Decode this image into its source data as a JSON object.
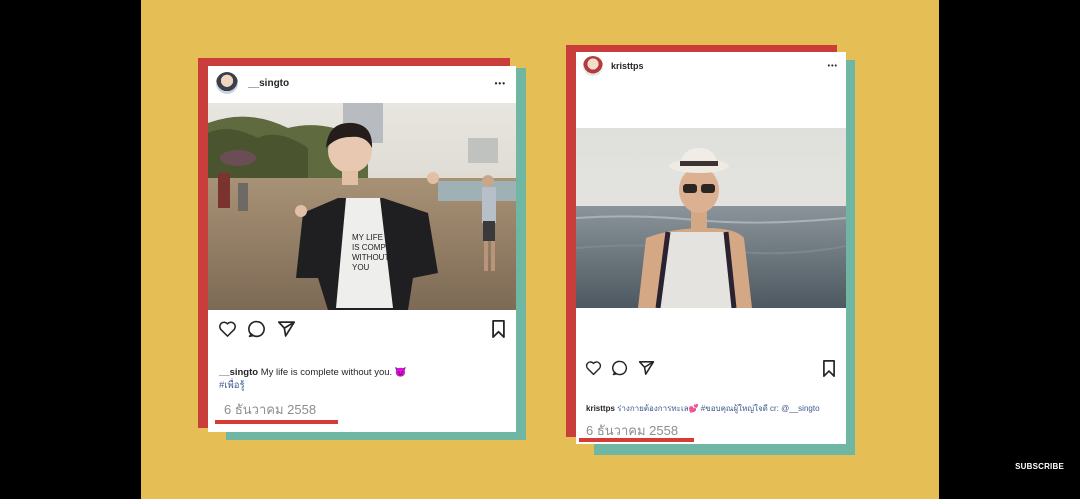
{
  "post_left": {
    "username": "__singto",
    "more_label": "•••",
    "caption_user": "__singto",
    "caption_text": " My life is complete without you. 😈",
    "hashtag": "#เพื่อรู้",
    "date": "6 ธันวาคม 2558",
    "shirt_text": "MY LIFE IS COMPLETE WITHOUT YOU"
  },
  "post_right": {
    "username": "kristtps",
    "more_label": "•••",
    "caption_user": "kristtps",
    "caption_text": " ร่างกายต้องการทะเล💕 #ขอบคุณผู้ใหญ่ใจดี cr: @__singto",
    "date": "6 ธันวาคม 2558"
  },
  "subscribe_label": "SUBSCRIBE",
  "colors": {
    "background": "#e5bf55",
    "red_frame": "#c93d3a",
    "teal_frame": "#6fb6a3",
    "underline": "#d63c35"
  }
}
